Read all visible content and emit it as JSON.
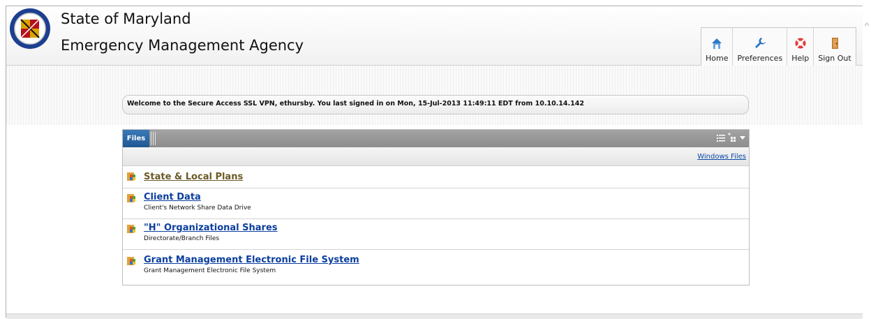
{
  "header": {
    "title_line1": "State of Maryland",
    "title_line2": "Emergency Management Agency",
    "logo_icon": "maryland-emergency-management-seal"
  },
  "nav": {
    "items": [
      {
        "label": "Home",
        "icon": "home-icon"
      },
      {
        "label": "Preferences",
        "icon": "wrench-icon"
      },
      {
        "label": "Help",
        "icon": "lifebuoy-icon"
      },
      {
        "label": "Sign Out",
        "icon": "door-icon"
      }
    ]
  },
  "welcome": {
    "message": "Welcome to the Secure Access SSL VPN, ethursby.  You last signed in on  Mon, 15-Jul-2013 11:49:11 EDT   from  10.10.14.142"
  },
  "files_panel": {
    "tab_label": "Files",
    "windows_files_link": "Windows Files",
    "items": [
      {
        "title": "State & Local Plans",
        "description": ""
      },
      {
        "title": "Client Data",
        "description": "Client's Network Share Data Drive"
      },
      {
        "title": "\"H\" Organizational Shares",
        "description": "Directorate/Branch Files"
      },
      {
        "title": "Grant Management Electronic File System",
        "description": "Grant Management Electronic File System"
      }
    ]
  },
  "colors": {
    "link": "#0b3e9e",
    "visited_link": "#6b5a28",
    "tab_blue": "#1f5894",
    "panel_header": "#9a9a9a"
  }
}
